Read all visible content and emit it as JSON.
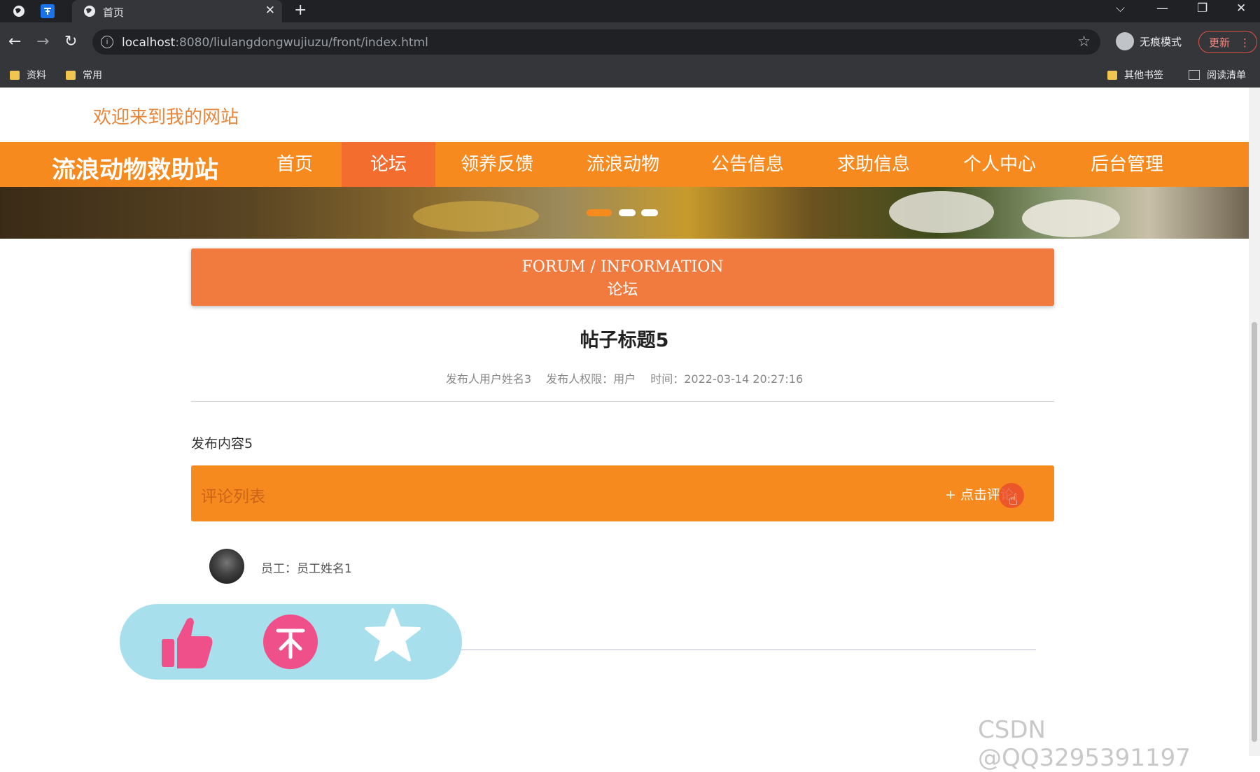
{
  "browser": {
    "tab_title": "首页",
    "tab_close": "✕",
    "new_tab": "+",
    "url_host": "localhost",
    "url_rest": ":8080/liulangdongwujiuzu/front/index.html",
    "incognito_label": "无痕模式",
    "update_label": "更新",
    "bookmarks": [
      "资料",
      "常用"
    ],
    "other_bookmarks": "其他书签",
    "reading_list": "阅读清单"
  },
  "site": {
    "welcome": "欢迎来到我的网站",
    "brand": "流浪动物救助站",
    "nav": [
      "首页",
      "论坛",
      "领养反馈",
      "流浪动物",
      "公告信息",
      "求助信息",
      "个人中心",
      "后台管理"
    ],
    "active_nav": "论坛"
  },
  "forum": {
    "header_en": "FORUM / INFORMATION",
    "header_cn": "论坛",
    "post_title": "帖子标题5",
    "meta_author": "发布人用户姓名3",
    "meta_role": "发布人权限：用户",
    "meta_time": "时间：2022-03-14 20:27:16",
    "post_content": "发布内容5"
  },
  "comments": {
    "title": "评论列表",
    "add_label": "+ 点击评论",
    "items": [
      {
        "user": "员工：员工姓名1"
      }
    ]
  },
  "actions": {
    "icons": [
      "thumbs-up-icon",
      "dislike-icon",
      "star-icon"
    ],
    "colors": {
      "like": "#f0508a",
      "dislike": "#f0508a",
      "star": "#ffffff",
      "panel": "#a7e0ec"
    }
  },
  "watermark": "CSDN @QQ3295391197",
  "colors": {
    "nav": "#f68a1f",
    "active_nav": "#f36d2f",
    "forum_header": "#f17a3f",
    "welcome": "#e7873d"
  }
}
